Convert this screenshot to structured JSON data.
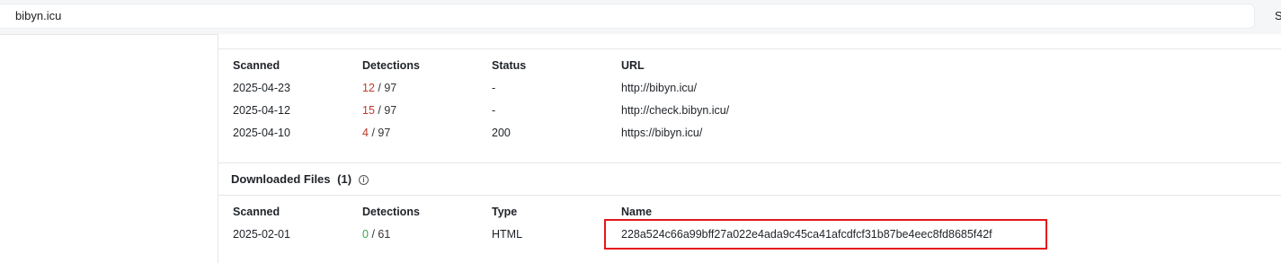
{
  "address_bar": {
    "value": "bibyn.icu",
    "right_text": "S"
  },
  "urls_section": {
    "clipped_title": "........",
    "headers": {
      "scanned": "Scanned",
      "detections": "Detections",
      "status": "Status",
      "url": "URL"
    },
    "rows": [
      {
        "scanned": "2025-04-23",
        "det_count": "12",
        "det_total": "/ 97",
        "status": "-",
        "url": "http://bibyn.icu/"
      },
      {
        "scanned": "2025-04-12",
        "det_count": "15",
        "det_total": "/ 97",
        "status": "-",
        "url": "http://check.bibyn.icu/"
      },
      {
        "scanned": "2025-04-10",
        "det_count": "4",
        "det_total": "/ 97",
        "status": "200",
        "url": "https://bibyn.icu/"
      }
    ]
  },
  "downloaded_files": {
    "title": "Downloaded Files",
    "count": "(1)",
    "info_icon": "i",
    "headers": {
      "scanned": "Scanned",
      "detections": "Detections",
      "type": "Type",
      "name": "Name"
    },
    "rows": [
      {
        "scanned": "2025-02-01",
        "det_count": "0",
        "det_total": "/ 61",
        "type": "HTML",
        "name": "228a524c66a99bff27a022e4ada9c45ca41afcdfcf31b87be4eec8fd8685f42f"
      }
    ]
  },
  "colors": {
    "malicious": "#c0392b",
    "clean": "#3aa64a",
    "highlight": "#e5161a"
  }
}
